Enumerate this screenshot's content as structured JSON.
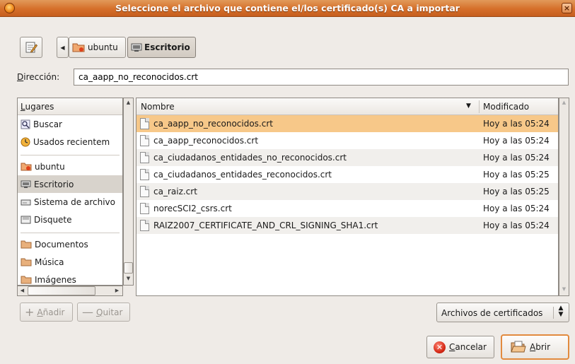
{
  "window": {
    "title": "Seleccione el archivo que contiene el/los certificado(s) CA a importar",
    "close_glyph": "×"
  },
  "pathbar": {
    "crumbs": [
      {
        "label": "ubuntu",
        "icon": "home-folder-icon"
      },
      {
        "label": "Escritorio",
        "icon": "desktop-icon",
        "active": true
      }
    ]
  },
  "location": {
    "label_mnemonic": "D",
    "label_rest": "irección:",
    "value": "ca_aapp_no_reconocidos.crt"
  },
  "places": {
    "header_mnemonic": "L",
    "header_rest": "ugares",
    "items": [
      {
        "label": "Buscar",
        "icon": "search-icon"
      },
      {
        "label": "Usados recientem",
        "icon": "recent-icon"
      },
      {
        "label": "ubuntu",
        "icon": "home-folder-icon"
      },
      {
        "label": "Escritorio",
        "icon": "desktop-icon",
        "selected": true
      },
      {
        "label": "Sistema de archivo",
        "icon": "filesystem-icon"
      },
      {
        "label": "Disquete",
        "icon": "floppy-icon"
      },
      {
        "label": "Documentos",
        "icon": "folder-icon"
      },
      {
        "label": "Música",
        "icon": "folder-icon"
      },
      {
        "label": "Imágenes",
        "icon": "folder-icon"
      }
    ]
  },
  "files": {
    "col_name": "Nombre",
    "col_modified": "Modificado",
    "rows": [
      {
        "name": "ca_aapp_no_reconocidos.crt",
        "modified": "Hoy a las 05:24",
        "selected": true
      },
      {
        "name": "ca_aapp_reconocidos.crt",
        "modified": "Hoy a las 05:24"
      },
      {
        "name": "ca_ciudadanos_entidades_no_reconocidos.crt",
        "modified": "Hoy a las 05:24"
      },
      {
        "name": "ca_ciudadanos_entidades_reconocidos.crt",
        "modified": "Hoy a las 05:25"
      },
      {
        "name": "ca_raiz.crt",
        "modified": "Hoy a las 05:25"
      },
      {
        "name": "norecSCI2_csrs.crt",
        "modified": "Hoy a las 05:24"
      },
      {
        "name": "RAIZ2007_CERTIFICATE_AND_CRL_SIGNING_SHA1.crt",
        "modified": "Hoy a las 05:24"
      }
    ]
  },
  "buttons": {
    "add_mnemonic": "A",
    "add_rest": "ñadir",
    "remove_mnemonic": "Q",
    "remove_rest": "uitar",
    "cancel_mnemonic": "C",
    "cancel_rest": "ancelar",
    "open_mnemonic": "A",
    "open_rest": "brir"
  },
  "filter": {
    "selected": "Archivos de certificados"
  },
  "colors": {
    "titlebar": "#d56f2a",
    "selection": "#f7c889",
    "default_button_border": "#e28a3e"
  }
}
